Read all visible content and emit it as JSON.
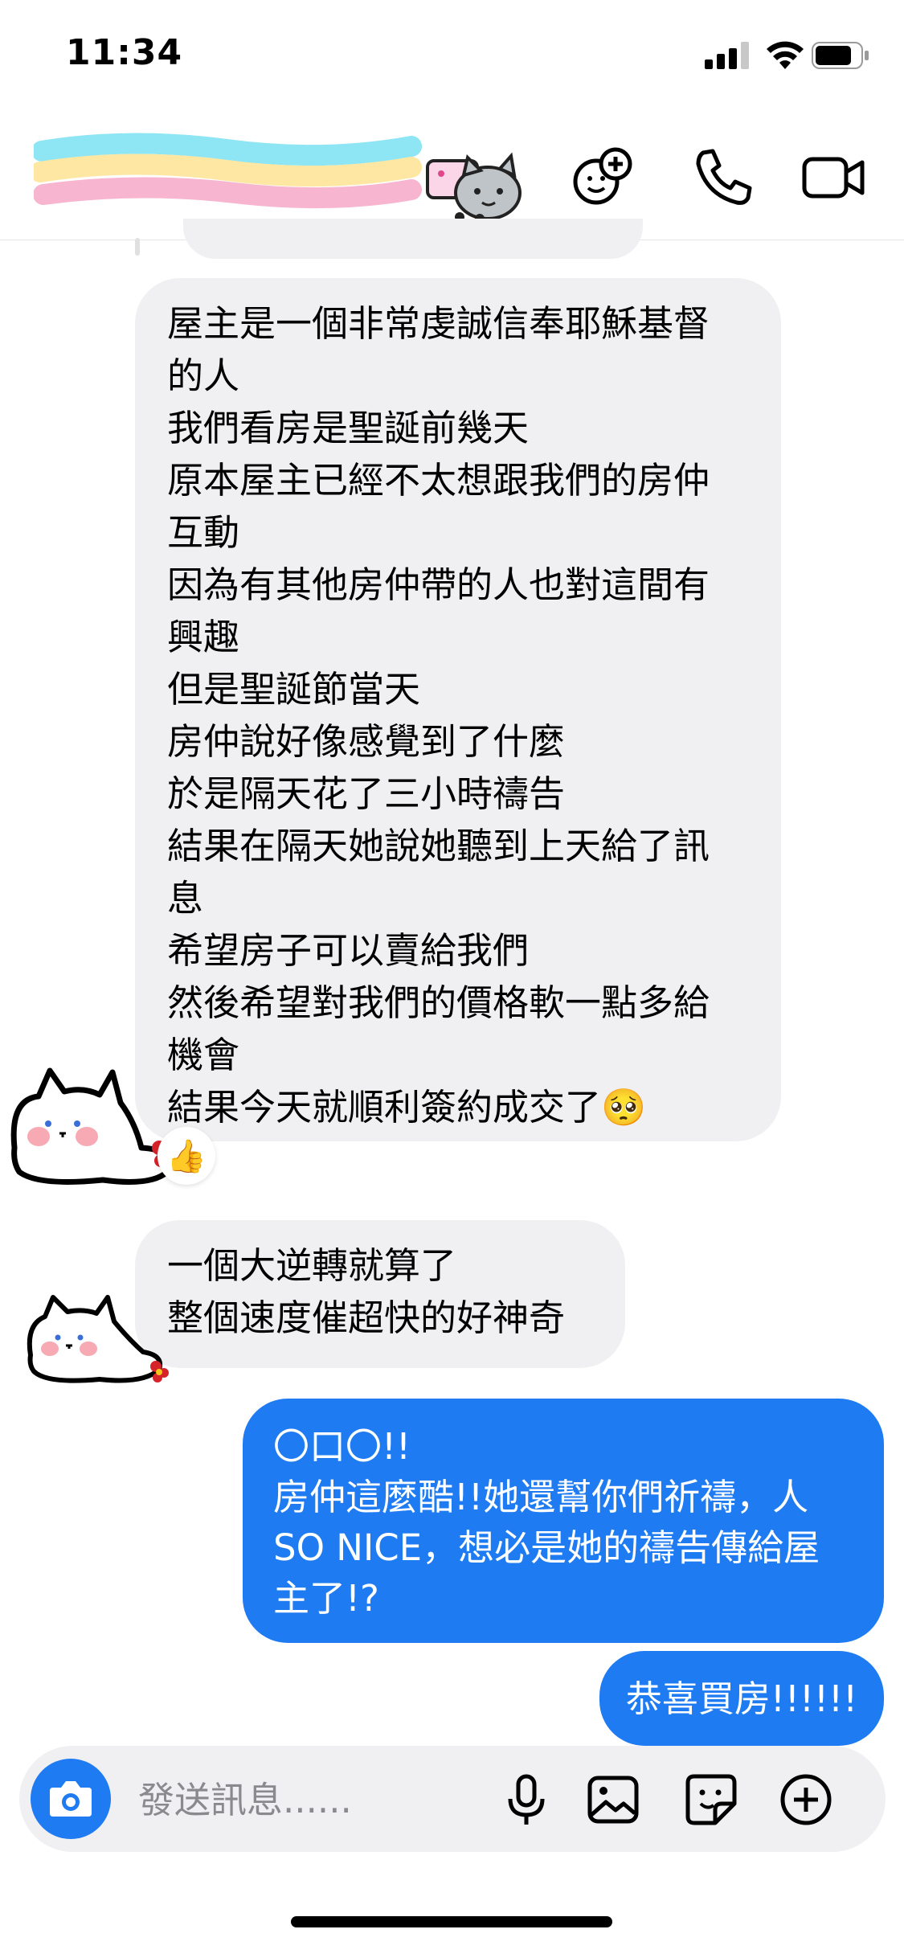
{
  "status_bar": {
    "time": "11:34",
    "icons": [
      "signal-icon",
      "wifi-icon",
      "battery-icon"
    ]
  },
  "header": {
    "contact_name_hidden": "scribbled-over contact name",
    "buttons": [
      "group-add-icon",
      "phone-call-icon",
      "video-call-icon"
    ]
  },
  "messages": [
    {
      "direction": "incoming",
      "lines": [
        "屋主是一個非常虔誠信奉耶穌基督",
        "的人",
        "我們看房是聖誕前幾天",
        "原本屋主已經不太想跟我們的房仲",
        "互動",
        "因為有其他房仲帶的人也對這間有",
        "興趣",
        "但是聖誕節當天",
        "房仲說好像感覺到了什麼",
        "於是隔天花了三小時禱告",
        "結果在隔天她說她聽到上天給了訊",
        "息",
        "希望房子可以賣給我們",
        "然後希望對我們的價格軟一點多給",
        "機會",
        "結果今天就順利簽約成交了🥺"
      ],
      "reaction": "👍"
    },
    {
      "direction": "incoming",
      "lines": [
        "一個大逆轉就算了",
        "整個速度催超快的好神奇"
      ]
    },
    {
      "direction": "outgoing",
      "lines": [
        "〇口〇!!",
        "房仲這麼酷!!她還幫你們祈禱，人",
        "SO NICE，想必是她的禱告傳給屋",
        "主了!?"
      ]
    },
    {
      "direction": "outgoing",
      "lines": [
        "恭喜買房!!!!!!"
      ]
    }
  ],
  "composer": {
    "placeholder": "發送訊息......",
    "icons": [
      "camera-icon",
      "microphone-icon",
      "image-icon",
      "sticker-icon",
      "plus-icon"
    ]
  },
  "colors": {
    "accent": "#1f7bf2",
    "incoming_bubble": "#f0f0f2",
    "outgoing_text": "#ffffff"
  }
}
